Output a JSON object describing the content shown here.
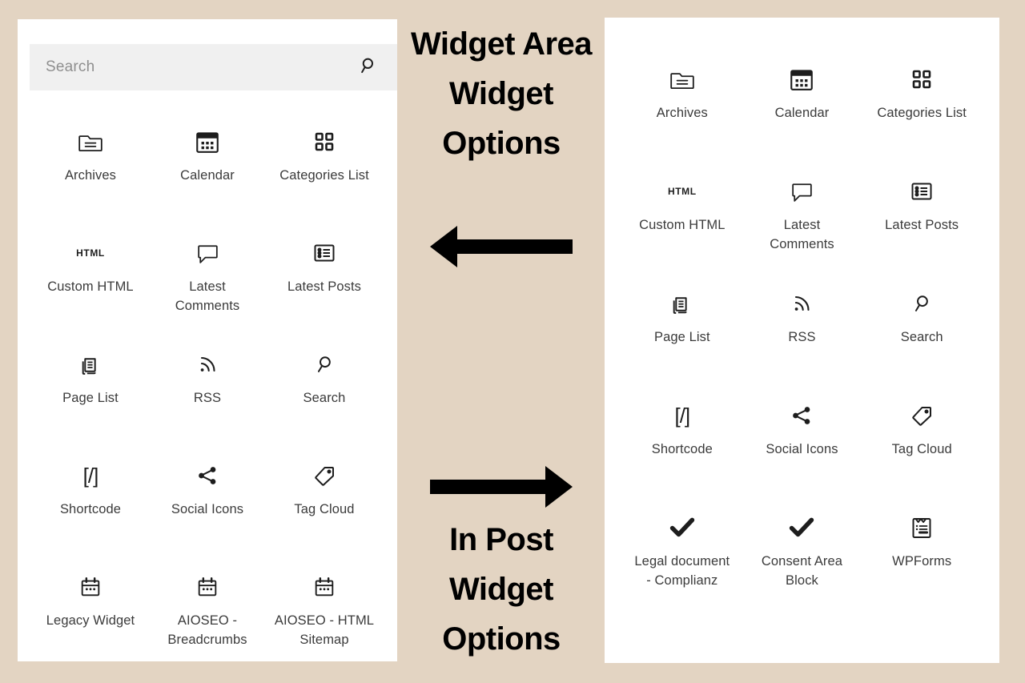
{
  "background_color": "#e3d4c2",
  "center": {
    "widget_area_heading": "Widget Area Widget Options",
    "in_post_heading": "In Post Widget Options",
    "arrow_left_name": "arrow-left-icon",
    "arrow_right_name": "arrow-right-icon"
  },
  "widget_area_panel": {
    "search": {
      "placeholder": "Search",
      "value": "",
      "icon": "search-icon"
    },
    "widgets": [
      {
        "label": "Archives",
        "icon": "folder-archive-icon"
      },
      {
        "label": "Calendar",
        "icon": "calendar-icon"
      },
      {
        "label": "Categories List",
        "icon": "grid-squares-icon"
      },
      {
        "label": "Custom HTML",
        "icon": "html-text-icon"
      },
      {
        "label": "Latest Comments",
        "icon": "comment-bubble-icon"
      },
      {
        "label": "Latest Posts",
        "icon": "list-view-icon"
      },
      {
        "label": "Page List",
        "icon": "page-list-icon"
      },
      {
        "label": "RSS",
        "icon": "rss-icon"
      },
      {
        "label": "Search",
        "icon": "search-icon"
      },
      {
        "label": "Shortcode",
        "icon": "shortcode-icon"
      },
      {
        "label": "Social Icons",
        "icon": "share-icon"
      },
      {
        "label": "Tag Cloud",
        "icon": "tag-icon"
      },
      {
        "label": "Legacy Widget",
        "icon": "legacy-calendar-icon"
      },
      {
        "label": "AIOSEO - Breadcrumbs",
        "icon": "legacy-calendar-icon"
      },
      {
        "label": "AIOSEO - HTML Sitemap",
        "icon": "legacy-calendar-icon"
      }
    ]
  },
  "in_post_panel": {
    "widgets": [
      {
        "label": "Archives",
        "icon": "folder-archive-icon"
      },
      {
        "label": "Calendar",
        "icon": "calendar-icon"
      },
      {
        "label": "Categories List",
        "icon": "grid-squares-icon"
      },
      {
        "label": "Custom HTML",
        "icon": "html-text-icon"
      },
      {
        "label": "Latest Comments",
        "icon": "comment-bubble-icon"
      },
      {
        "label": "Latest Posts",
        "icon": "list-view-icon"
      },
      {
        "label": "Page List",
        "icon": "page-list-icon"
      },
      {
        "label": "RSS",
        "icon": "rss-icon"
      },
      {
        "label": "Search",
        "icon": "search-icon"
      },
      {
        "label": "Shortcode",
        "icon": "shortcode-icon"
      },
      {
        "label": "Social Icons",
        "icon": "share-icon"
      },
      {
        "label": "Tag Cloud",
        "icon": "tag-icon"
      },
      {
        "label": "Legal document - Complianz",
        "icon": "checkmark-icon"
      },
      {
        "label": "Consent Area Block",
        "icon": "checkmark-icon"
      },
      {
        "label": "WPForms",
        "icon": "clipboard-form-icon"
      }
    ]
  }
}
